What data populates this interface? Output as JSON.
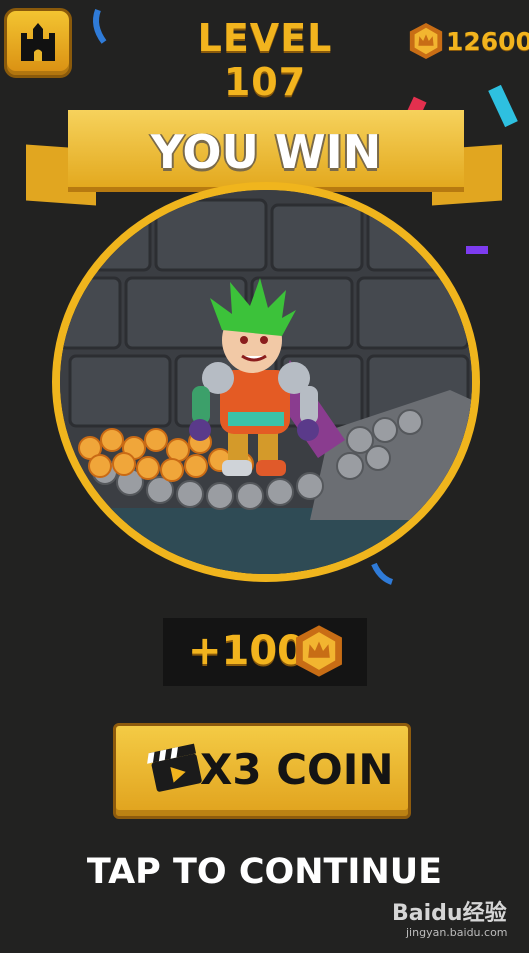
{
  "header": {
    "level_title": "LEVEL 107",
    "coin_count": "12600",
    "home_icon": "castle-icon"
  },
  "banner": {
    "title": "YOU WIN"
  },
  "reward": {
    "amount": "+100",
    "icon": "crown-coin-icon"
  },
  "x3_button": {
    "label": "X3 COIN",
    "icon": "video-clapper-icon"
  },
  "continue_text": "TAP TO CONTINUE",
  "watermark": {
    "brand": "Baidu经验",
    "url": "jingyan.baidu.com"
  },
  "colors": {
    "background": "#222221",
    "gold": "#f2b41e",
    "banner_gold": "#e3a91f",
    "hero_hair": "#3cc23a"
  }
}
